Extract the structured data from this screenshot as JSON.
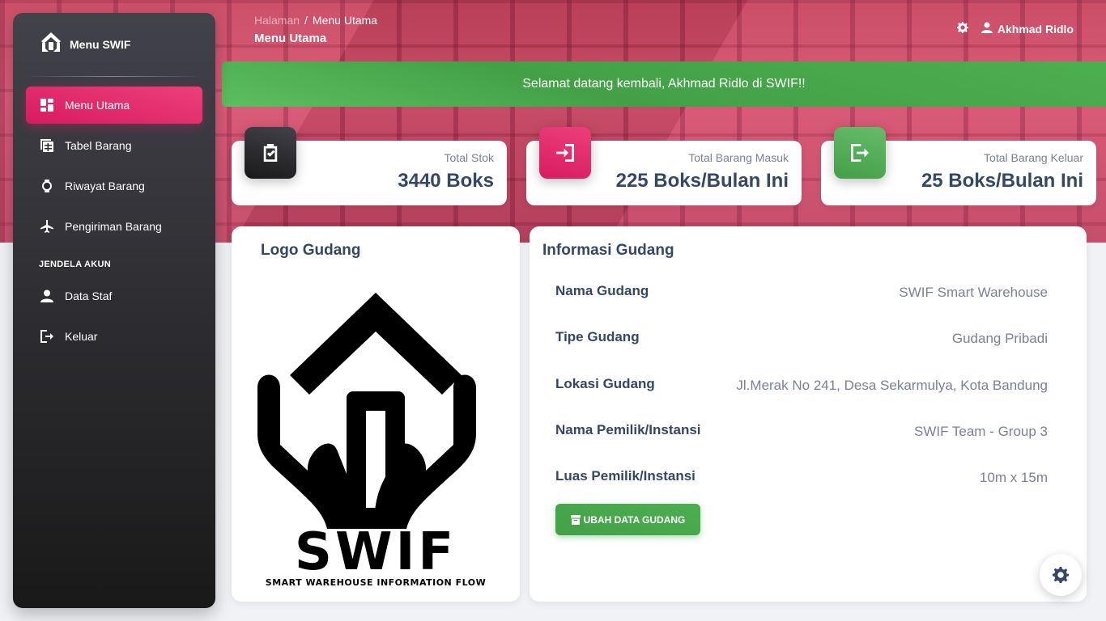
{
  "brand": {
    "title": "Menu SWIF"
  },
  "sidebar": {
    "items": [
      {
        "label": "Menu Utama",
        "icon": "dashboard-icon",
        "active": true
      },
      {
        "label": "Tabel Barang",
        "icon": "table-icon"
      },
      {
        "label": "Riwayat Barang",
        "icon": "watch-icon"
      },
      {
        "label": "Pengiriman Barang",
        "icon": "airplane-icon"
      }
    ],
    "section_title": "JENDELA AKUN",
    "account_items": [
      {
        "label": "Data Staf",
        "icon": "person-icon"
      },
      {
        "label": "Keluar",
        "icon": "logout-icon"
      }
    ]
  },
  "header": {
    "breadcrumb_root": "Halaman",
    "breadcrumb_sep": "/",
    "breadcrumb_current": "Menu Utama",
    "page_title": "Menu Utama",
    "user_name": "Akhmad Ridlo"
  },
  "alert": {
    "message": "Selamat datang kembali, Akhmad Ridlo di SWIF!!"
  },
  "stats": [
    {
      "label": "Total Stok",
      "value": "3440 Boks",
      "icon": "clipboard-check-icon",
      "color": "#191919"
    },
    {
      "label": "Total Barang Masuk",
      "value": "225 Boks/Bulan Ini",
      "icon": "login-icon",
      "color": "#d81b60"
    },
    {
      "label": "Total Barang Keluar",
      "value": "25 Boks/Bulan Ini",
      "icon": "logout-icon",
      "color": "#43a047"
    }
  ],
  "logo_card": {
    "title": "Logo Gudang",
    "logo_word": "SWIF",
    "logo_tagline": "SMART WAREHOUSE INFORMATION FLOW"
  },
  "info_card": {
    "title": "Informasi Gudang",
    "rows": [
      {
        "key": "Nama Gudang",
        "value": "SWIF Smart Warehouse"
      },
      {
        "key": "Tipe Gudang",
        "value": "Gudang Pribadi"
      },
      {
        "key": "Lokasi Gudang",
        "value": "Jl.Merak No 241, Desa Sekarmulya, Kota Bandung"
      },
      {
        "key": "Nama Pemilik/Instansi",
        "value": "SWIF Team - Group 3"
      },
      {
        "key": "Luas Pemilik/Instansi",
        "value": "10m x 15m"
      }
    ],
    "button_label": "UBAH DATA GUDANG"
  },
  "colors": {
    "accent_pink": "#e91e63",
    "success_green": "#4caf50",
    "text_dark": "#344767",
    "text_muted": "#7b809a"
  }
}
